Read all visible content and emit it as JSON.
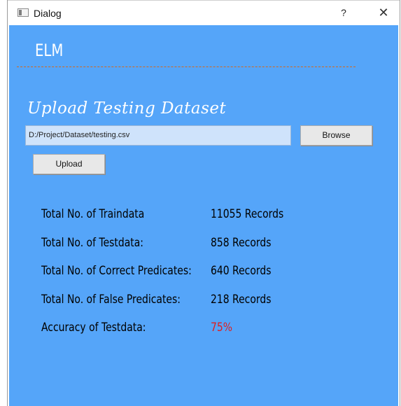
{
  "window": {
    "title": "Dialog",
    "help_glyph": "?",
    "close_glyph": "✕"
  },
  "app": {
    "title": "ELM"
  },
  "upload": {
    "section_title": "Upload Testing Dataset",
    "path_value": "D:/Project/Dataset/testing.csv",
    "browse_label": "Browse",
    "upload_label": "Upload"
  },
  "stats": [
    {
      "label": "Total No. of Traindata",
      "value": "11055 Records"
    },
    {
      "label": "Total No. of Testdata:",
      "value": "858 Records"
    },
    {
      "label": "Total No. of Correct Predicates:",
      "value": "640 Records"
    },
    {
      "label": "Total No. of False Predicates:",
      "value": "218 Records"
    },
    {
      "label": "Accuracy of Testdata:",
      "value": "75%"
    }
  ],
  "colors": {
    "client_background": "#55a5f9",
    "accuracy_value": "#e01e1e"
  },
  "icons": {
    "window_icon": "window-icon",
    "help": "help-icon",
    "close": "close-icon"
  }
}
